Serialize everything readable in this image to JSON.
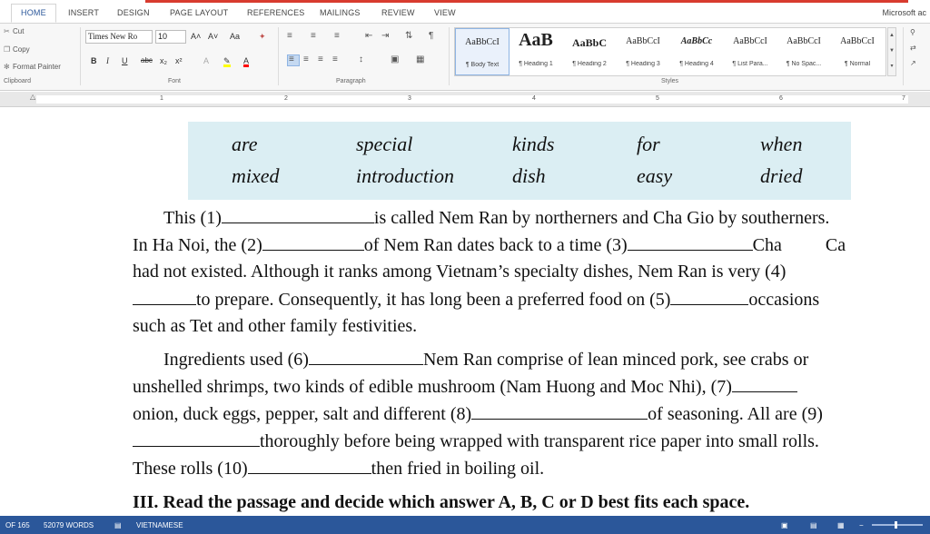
{
  "ribbon_tabs": [
    "HOME",
    "INSERT",
    "DESIGN",
    "PAGE LAYOUT",
    "REFERENCES",
    "MAILINGS",
    "REVIEW",
    "VIEW"
  ],
  "account": "Microsoft ac",
  "clipboard": {
    "cut": "Cut",
    "copy": "Copy",
    "format_painter": "Format Painter",
    "group_label": "Clipboard"
  },
  "font": {
    "name": "Times New Ro",
    "size": "10",
    "grow": "A˄",
    "shrink": "A˅",
    "case": "Aa",
    "bold": "B",
    "italic": "I",
    "underline": "U",
    "strike": "abc",
    "sub": "x₂",
    "sup": "x²",
    "group_label": "Font"
  },
  "paragraph": {
    "group_label": "Paragraph"
  },
  "styles": {
    "group_label": "Styles",
    "items": [
      {
        "sample": "AaBbCcI",
        "name": "¶ Body Text"
      },
      {
        "sample": "AaB",
        "name": "¶ Heading 1"
      },
      {
        "sample": "AaBbC",
        "name": "¶ Heading 2"
      },
      {
        "sample": "AaBbCcI",
        "name": "¶ Heading 3"
      },
      {
        "sample": "AaBbCc",
        "name": "¶ Heading 4"
      },
      {
        "sample": "AaBbCcI",
        "name": "¶ List Para..."
      },
      {
        "sample": "AaBbCcI",
        "name": "¶ No Spac..."
      },
      {
        "sample": "AaBbCcI",
        "name": "¶ Normal"
      }
    ]
  },
  "ruler_numbers": [
    "1",
    "2",
    "3",
    "4",
    "5",
    "6",
    "7"
  ],
  "word_box": {
    "row1": [
      "are",
      "special",
      "kinds",
      "for",
      "when"
    ],
    "row2": [
      "mixed",
      "introduction",
      "dish",
      "easy",
      "dried"
    ]
  },
  "para1": {
    "l1a": "This (1)",
    "l1b": "is called Nem Ran by northerners and Cha Gio by southerners.",
    "l2a": "In Ha Noi, the (2)",
    "l2b": "of Nem Ran dates back to a time (3)",
    "l2c": "Cha",
    "l2d": "Ca",
    "l3": "had not existed. Although it ranks among Vietnam’s specialty dishes, Nem Ran is very (4)",
    "l4a": "to prepare. Consequently, it has long been a preferred food on (5)",
    "l4b": "occasions",
    "l5": "such as Tet and other family festivities."
  },
  "para2": {
    "l1a": "Ingredients used (6)",
    "l1b": "Nem Ran comprise of lean minced pork, see crabs or",
    "l2a": "unshelled shrimps, two kinds of edible mushroom (Nam Huong and Moc Nhi), (7)",
    "l3a": "onion, duck eggs, pepper, salt and different (8)",
    "l3b": "of seasoning. All are (9)",
    "l4b": "thoroughly before being wrapped with transparent rice paper into small rolls.",
    "l5a": "These rolls (10)",
    "l5b": "then fried in boiling oil."
  },
  "next_section": "III. Read the passage and decide which answer A, B, C or D best fits each space.",
  "status": {
    "page": "OF 165",
    "words": "52079 WORDS",
    "language": "VIETNAMESE"
  }
}
